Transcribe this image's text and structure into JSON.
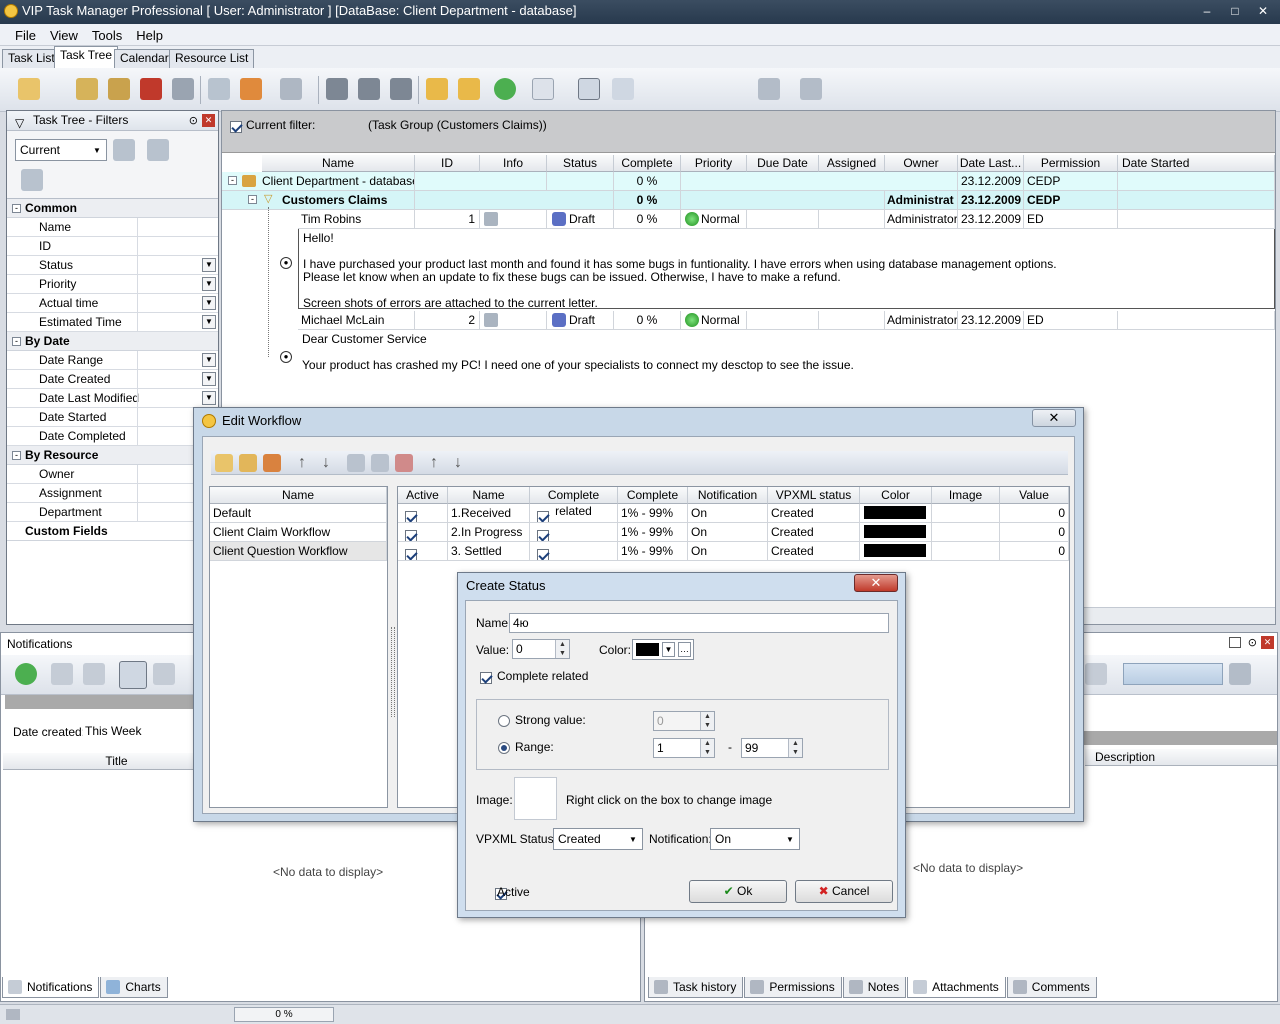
{
  "app": {
    "title": "VIP Task Manager Professional [ User: Administrator ] [DataBase: Client Department - database]"
  },
  "menu": [
    "File",
    "View",
    "Tools",
    "Help"
  ],
  "main_tabs": [
    "Task List",
    "Task Tree",
    "Calendar",
    "Resource List"
  ],
  "filters_panel": {
    "title": "Task Tree - Filters",
    "current": "Current",
    "common_label": "Common",
    "common_items": [
      "Name",
      "ID",
      "Status",
      "Priority",
      "Actual time",
      "Estimated Time"
    ],
    "bydate_label": "By Date",
    "bydate_items": [
      "Date Range",
      "Date Created",
      "Date Last Modified",
      "Date Started",
      "Date Completed"
    ],
    "byresource_label": "By Resource",
    "byresource_items": [
      "Owner",
      "Assignment",
      "Department"
    ],
    "custom_label": "Custom Fields"
  },
  "filter_bar": {
    "label": "Current filter:",
    "value": "(Task Group  (Customers Claims))"
  },
  "grid": {
    "columns": [
      "Name",
      "ID",
      "Info",
      "Status",
      "Complete",
      "Priority",
      "Due Date",
      "Assigned",
      "Owner",
      "Date Last...",
      "Permission",
      "Date Started"
    ],
    "db_row": {
      "name": "Client Department - database",
      "complete": "0 %",
      "date": "23.12.2009",
      "perm": "CEDP"
    },
    "group_row": {
      "name": "Customers Claims",
      "complete": "0 %",
      "owner": "Administrat",
      "date": "23.12.2009",
      "perm": "CEDP"
    },
    "tasks": [
      {
        "name": "Tim Robins",
        "id": "1",
        "status": "Draft",
        "complete": "0 %",
        "priority": "Normal",
        "owner": "Administrator",
        "date": "23.12.2009",
        "perm": "ED",
        "note": [
          "Hello!",
          "",
          "I have purchased your product last month and found it has some bugs in funtionality. I have errors when using database management options.",
          "Please let know when an update to fix these bugs can be issued. Otherwise, I have to make a refund.",
          "",
          "Screen shots of errors are attached to the current letter."
        ]
      },
      {
        "name": "Michael McLain",
        "id": "2",
        "status": "Draft",
        "complete": "0 %",
        "priority": "Normal",
        "owner": "Administrator",
        "date": "23.12.2009",
        "perm": "ED",
        "note": [
          "Dear Customer Service",
          "",
          "Your product has crashed my PC! I need one of your specialists to connect my desctop to see the issue."
        ]
      }
    ]
  },
  "notifications": {
    "title": "Notifications",
    "date_created_label": "Date created:",
    "date_created_value": "This Week",
    "title_col": "Title",
    "no_data": "<No data to display>"
  },
  "right_panel": {
    "description_col": "Description",
    "no_data": "<No data to display>"
  },
  "bottom_tabs_left": [
    "Notifications",
    "Charts"
  ],
  "bottom_tabs_right": [
    "Task history",
    "Permissions",
    "Notes",
    "Attachments",
    "Comments"
  ],
  "status_bar": {
    "progress": "0 %"
  },
  "edit_workflow": {
    "title": "Edit Workflow",
    "list_header": "Name",
    "workflows": [
      "Default",
      "Client Claim Workflow",
      "Client Question Workflow"
    ],
    "columns": [
      "Active",
      "Name",
      "Complete related",
      "Complete",
      "Notification",
      "VPXML status",
      "Color",
      "Image",
      "Value"
    ],
    "rows": [
      {
        "name": "1.Received",
        "complete": "1% - 99%",
        "notification": "On",
        "vpxml": "Created",
        "value": "0"
      },
      {
        "name": "2.In Progress",
        "complete": "1% - 99%",
        "notification": "On",
        "vpxml": "Created",
        "value": "0"
      },
      {
        "name": "3. Settled",
        "complete": "1% - 99%",
        "notification": "On",
        "vpxml": "Created",
        "value": "0"
      }
    ]
  },
  "create_status": {
    "title": "Create Status",
    "name_label": "Name",
    "name_value": "4ю",
    "value_label": "Value:",
    "value_value": "0",
    "color_label": "Color:",
    "complete_related_label": "Complete related",
    "strong_label": "Strong value:",
    "strong_value": "0",
    "range_label": "Range:",
    "range_from": "1",
    "range_dash": "-",
    "range_to": "99",
    "image_label": "Image:",
    "image_hint": "Right click on the box to  change image",
    "vpxml_label": "VPXML Status:",
    "vpxml_value": "Created",
    "notification_label": "Notification:",
    "notification_value": "On",
    "active_label": "Active",
    "ok": "Ok",
    "cancel": "Cancel"
  }
}
